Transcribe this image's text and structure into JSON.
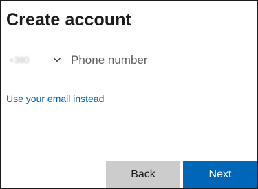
{
  "header": {
    "title": "Create account"
  },
  "phone": {
    "country_code": "+380",
    "placeholder": "Phone number",
    "dropdown_icon": "chevron-down-icon"
  },
  "links": {
    "use_email": "Use your email instead"
  },
  "buttons": {
    "back": "Back",
    "next": "Next"
  },
  "colors": {
    "accent": "#0067b8",
    "back_button": "#cccccc",
    "text": "#1b1b1b"
  }
}
